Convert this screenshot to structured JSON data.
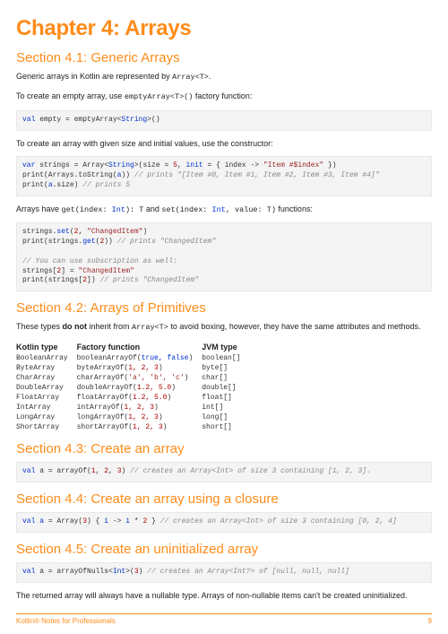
{
  "chapter_title": "Chapter 4: Arrays",
  "s41": {
    "heading": "Section 4.1: Generic Arrays",
    "p1_a": "Generic arrays in Kotlin are represented by ",
    "p1_code": "Array<T>",
    "p1_b": ".",
    "p2_a": "To create an empty array, use ",
    "p2_code": "emptyArray<T>()",
    "p2_b": " factory function:",
    "code1": {
      "kw_val": "val",
      "empty": " empty = emptyArray<",
      "string": "String",
      "tail": ">()"
    },
    "p3": "To create an array with given size and initial values, use the constructor:",
    "code2": {
      "l1a": "var",
      "l1b": " strings = Array<",
      "l1c": "String",
      "l1d": ">(size = ",
      "l1e": "5",
      "l1f": ", ",
      "l1g": "init",
      "l1h": " = { index -> ",
      "l1i": "\"Item #$index\"",
      "l1j": " })",
      "l2a": "print(Arrays.toString(",
      "l2b": "a",
      "l2c": ")) ",
      "l2d": "// prints \"[Item #0, Item #1, Item #2, Item #3, Item #4]\"",
      "l3a": "print(",
      "l3b": "a",
      "l3c": ".size) ",
      "l3d": "// prints 5"
    },
    "p4_a": "Arrays have ",
    "p4_code1": "get(index: ",
    "p4_int": "Int",
    "p4_b": "): T",
    "p4_c": " and ",
    "p4_code2": "set(index: ",
    "p4_d": ", value: T)",
    "p4_e": " functions:",
    "code3": {
      "l1a": "strings.",
      "l1b": "set",
      "l1c": "(",
      "l1d": "2",
      "l1e": ", ",
      "l1f": "\"ChangedItem\"",
      "l1g": ")",
      "l2a": "print(strings.",
      "l2b": "get",
      "l2c": "(",
      "l2d": "2",
      "l2e": ")) ",
      "l2f": "// prints \"ChangedItem\"",
      "l4": "// You can use subscription as well:",
      "l5a": "strings[",
      "l5b": "2",
      "l5c": "] = ",
      "l5d": "\"ChangedItem\"",
      "l6a": "print(strings[",
      "l6b": "2",
      "l6c": "]) ",
      "l6d": "// prints \"ChangedItem\""
    }
  },
  "s42": {
    "heading": "Section 4.2: Arrays of Primitives",
    "p1_a": "These types ",
    "p1_b": "do not",
    "p1_c": " inherit from ",
    "p1_code": "Array<T>",
    "p1_d": " to avoid boxing, however, they have the same attributes and methods.",
    "th1": "Kotlin type",
    "th2": "Factory function",
    "th3": "JVM type",
    "rows": [
      {
        "kt": "BooleanArray",
        "f_pre": "booleanArrayOf(",
        "f_args": "true, false",
        "f_post": ")",
        "jt": "boolean[]",
        "kw": true
      },
      {
        "kt": "ByteArray",
        "f_pre": "byteArrayOf(",
        "f_args": "1, 2, 3",
        "f_post": ")",
        "jt": "byte[]"
      },
      {
        "kt": "CharArray",
        "f_pre": "charArrayOf(",
        "f_args": "'a', 'b', 'c'",
        "f_post": ")",
        "jt": "char[]",
        "str": true
      },
      {
        "kt": "DoubleArray",
        "f_pre": "doubleArrayOf(",
        "f_args": "1.2, 5.0",
        "f_post": ")",
        "jt": "double[]"
      },
      {
        "kt": "FloatArray",
        "f_pre": "floatArrayOf(",
        "f_args": "1.2, 5.0",
        "f_post": ")",
        "jt": "float[]"
      },
      {
        "kt": "IntArray",
        "f_pre": "intArrayOf(",
        "f_args": "1, 2, 3",
        "f_post": ")",
        "jt": "int[]"
      },
      {
        "kt": "LongArray",
        "f_pre": "longArrayOf(",
        "f_args": "1, 2, 3",
        "f_post": ")",
        "jt": "long[]"
      },
      {
        "kt": "ShortArray",
        "f_pre": "shortArrayOf(",
        "f_args": "1, 2, 3",
        "f_post": ")",
        "jt": "short[]"
      }
    ]
  },
  "s43": {
    "heading": "Section 4.3: Create an array",
    "c": {
      "a": "val",
      "b": " a ",
      "c": "=",
      "d": " arrayOf(",
      "e": "1",
      "f": ", ",
      "g": "2",
      "h": ", ",
      "i": "3",
      "j": ") ",
      "k": "// creates an Array<Int> of size 3 containing [1, 2, 3]."
    }
  },
  "s44": {
    "heading": "Section 4.4: Create an array using a closure",
    "c": {
      "a": "val a",
      "b": " = Array(",
      "c": "3",
      "d": ") { ",
      "e": "i",
      "f": " -> ",
      "g": "i",
      "h": " * ",
      "i": "2",
      "j": " } ",
      "k": "// creates an Array<Int> of size 3 containing [0, 2, 4]"
    }
  },
  "s45": {
    "heading": "Section 4.5: Create an uninitialized array",
    "c": {
      "a": "val",
      "b": " a = arrayOfNulls<",
      "c": "Int",
      "d": ">(",
      "e": "3",
      "f": ") ",
      "g": "// creates an Array<Int?> of [null, null, null]"
    },
    "p": "The returned array will always have a nullable type. Arrays of non-nullable items can't be created uninitialized."
  },
  "footer": {
    "left": "Kotlin® Notes for Professionals",
    "right": "9"
  }
}
